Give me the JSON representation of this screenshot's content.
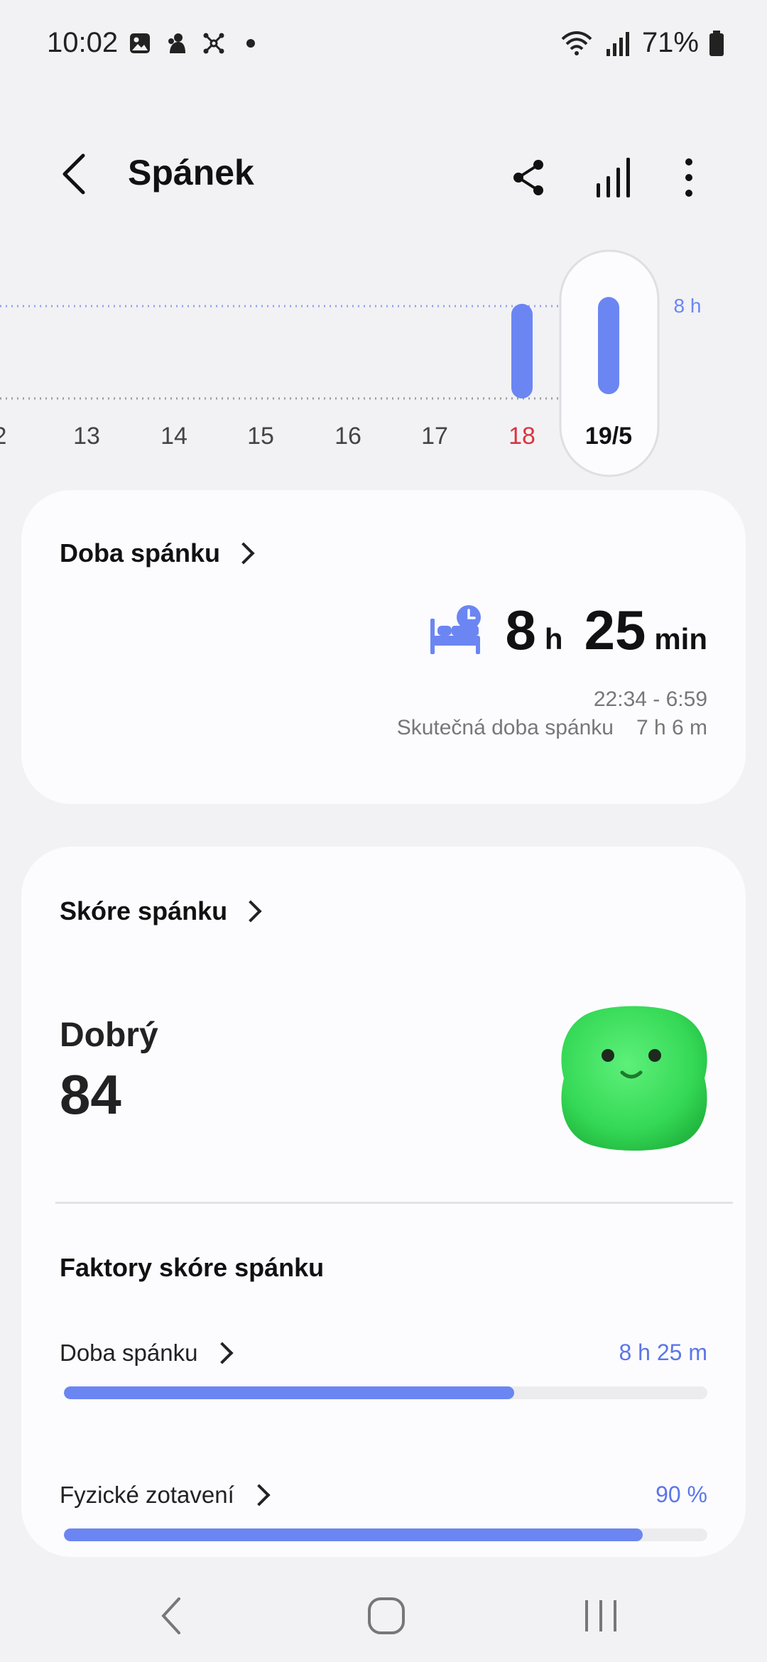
{
  "status_bar": {
    "time": "10:02",
    "battery": "71%"
  },
  "app_bar": {
    "title": "Spánek",
    "icons": [
      "back-arrow-icon",
      "share-icon",
      "bar-chart-icon",
      "more-vert-icon"
    ]
  },
  "chart_data": {
    "type": "bar",
    "categories": [
      "2",
      "13",
      "14",
      "15",
      "16",
      "17",
      "18",
      "19/5"
    ],
    "values": [
      null,
      null,
      null,
      null,
      null,
      null,
      8.2,
      8.42
    ],
    "reference_label": "8 h",
    "highlight_category": "19/5",
    "weekend_category": "18",
    "colors": {
      "bar": "#6b86f2",
      "weekend": "#d9363e",
      "reference": "#6b86f2"
    }
  },
  "sleep_time_card": {
    "title": "Doba spánku",
    "hours": "8",
    "hours_unit": "h",
    "minutes": "25",
    "minutes_unit": "min",
    "range": "22:34 - 6:59",
    "actual_label": "Skutečná doba spánku",
    "actual_value": "7 h 6 m"
  },
  "sleep_score_card": {
    "title": "Skóre spánku",
    "rating": "Dobrý",
    "score": "84",
    "factors_title": "Faktory skóre spánku",
    "factors": [
      {
        "label": "Doba spánku",
        "value": "8 h 25 m",
        "fraction": 0.7
      },
      {
        "label": "Fyzické zotavení",
        "value": "90 %",
        "fraction": 0.9
      }
    ]
  },
  "nav_bar": {
    "icons": [
      "nav-back-icon",
      "nav-home-icon",
      "nav-recents-icon"
    ]
  }
}
